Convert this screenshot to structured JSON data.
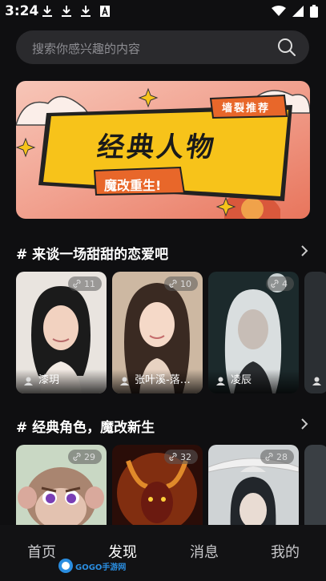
{
  "status": {
    "time": "3:24"
  },
  "search": {
    "placeholder": "搜索你感兴趣的内容"
  },
  "banner": {
    "title": "经典人物",
    "tag": "墙裂推荐",
    "subtitle": "魔改重生!"
  },
  "sections": [
    {
      "title": "# 来谈一场甜甜的恋爱吧",
      "cards": [
        {
          "name": "漆玥",
          "count": "11"
        },
        {
          "name": "张叶溪-落…",
          "count": "10"
        },
        {
          "name": "凌辰",
          "count": "4"
        }
      ]
    },
    {
      "title": "# 经典角色，魔改新生",
      "cards": [
        {
          "name": "",
          "count": "29"
        },
        {
          "name": "",
          "count": "32"
        },
        {
          "name": "",
          "count": "28"
        }
      ]
    }
  ],
  "nav": {
    "items": [
      "首页",
      "发现",
      "消息",
      "我的"
    ],
    "active_index": 1
  },
  "watermark": {
    "text": "GOGO手游网"
  },
  "colors": {
    "background": "#0f0f11",
    "search_bg": "#2a2a2d",
    "banner_yellow": "#f7c31a",
    "banner_orange": "#f28a2f"
  }
}
